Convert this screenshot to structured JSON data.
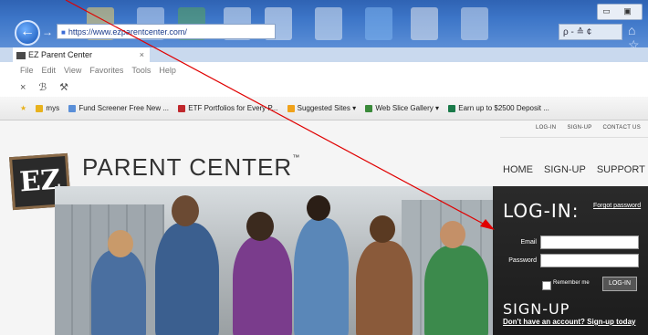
{
  "browser": {
    "address": "https://www.ezparentcenter.com/",
    "tab_title": "EZ Parent Center",
    "tab_close": "×",
    "back_glyph": "←",
    "forward_glyph": "→",
    "search_label": "ρ - ≙ ¢",
    "home_glyph": "⌂ ☆",
    "window_buttons": "▭ ▣",
    "menu": [
      "File",
      "Edit",
      "View",
      "Favorites",
      "Tools",
      "Help"
    ],
    "command_icons": [
      "×",
      "ℬ",
      "⚒"
    ],
    "favorites": [
      {
        "label": "mys",
        "color": "#e8b21d"
      },
      {
        "label": "Fund Screener  Free  New ...",
        "color": "#5a8fd8"
      },
      {
        "label": "ETF Portfolios for Every P...",
        "color": "#c0282d"
      },
      {
        "label": "Suggested Sites ▾",
        "color": "#f0a21a"
      },
      {
        "label": "Web Slice Gallery ▾",
        "color": "#3a8a3a"
      },
      {
        "label": "Earn up to $2500 Deposit ...",
        "color": "#1a7a4a"
      }
    ]
  },
  "site": {
    "toplinks": [
      "LOG-IN",
      "SIGN-UP",
      "CONTACT US"
    ],
    "logo_mark": "EZ",
    "logo_text": "PARENT CENTER",
    "logo_tm": "™",
    "nav": [
      "HOME",
      "SIGN-UP",
      "SUPPORT"
    ],
    "login": {
      "title": "LOG-IN:",
      "forgot": "Forgot password",
      "email_label": "Email",
      "password_label": "Password",
      "remember_label": "Remember me",
      "button": "LOG-IN"
    },
    "signup": {
      "title": "SIGN-UP",
      "link": "Don't have an account? Sign-up today"
    }
  },
  "colors": {
    "annotation_arrow": "#e00000",
    "login_panel": "#222222"
  }
}
